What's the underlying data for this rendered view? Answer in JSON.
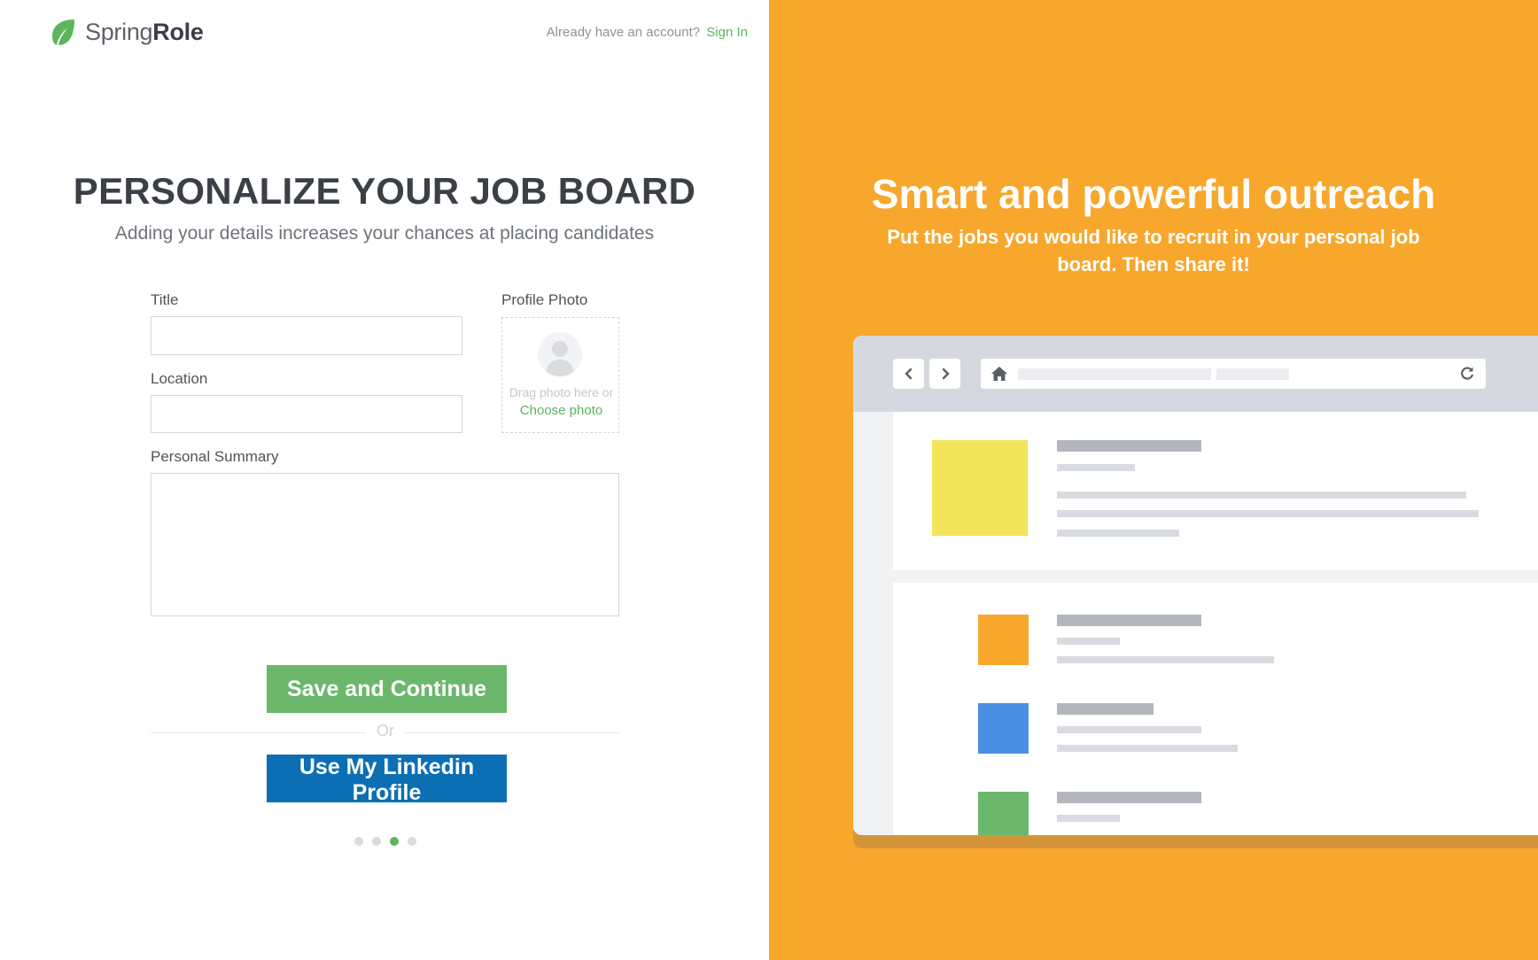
{
  "header": {
    "brand_light": "Spring",
    "brand_bold": "Role",
    "account_prompt": "Already have an account?",
    "sign_in_label": "Sign In"
  },
  "form": {
    "heading": "PERSONALIZE YOUR JOB BOARD",
    "subheading": "Adding your details increases your chances at placing candidates",
    "title_label": "Title",
    "title_value": "",
    "location_label": "Location",
    "location_value": "",
    "summary_label": "Personal Summary",
    "summary_value": "",
    "photo_label": "Profile Photo",
    "photo_drag_text": "Drag photo here or",
    "photo_choose_label": "Choose photo",
    "save_button_label": "Save and Continue",
    "or_text": "Or",
    "linkedin_button_label": "Use My Linkedin Profile"
  },
  "pagination": {
    "total": 4,
    "active_index": 2
  },
  "promo": {
    "title": "Smart and powerful outreach",
    "subtitle": "Put the jobs you would like to recruit in your personal job board. Then share it!",
    "job_colors": [
      "#f2e55a",
      "#f8a72d",
      "#4a90e2",
      "#6bb86c"
    ]
  },
  "colors": {
    "brand_green": "#5cb55e",
    "save_green": "#6bb86c",
    "linkedin_blue": "#0c6fb4",
    "promo_orange": "#f8a72d"
  }
}
